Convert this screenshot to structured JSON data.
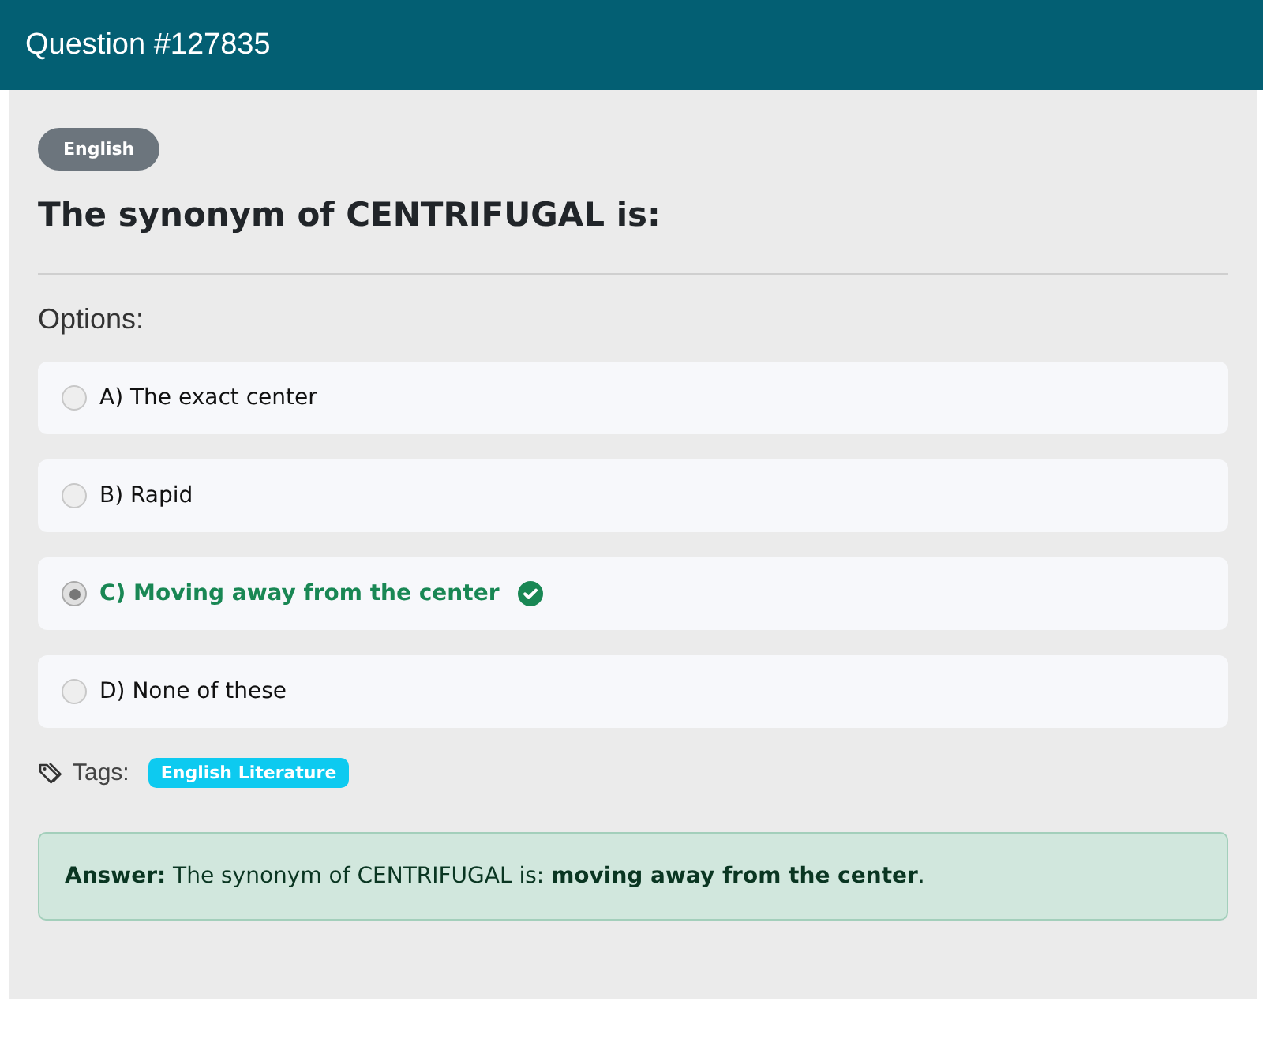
{
  "header": {
    "title": "Question #127835"
  },
  "category": "English",
  "question": "The synonym of CENTRIFUGAL is:",
  "options_label": "Options:",
  "options": [
    {
      "label": "A) The exact center",
      "selected": false,
      "correct": false
    },
    {
      "label": "B) Rapid",
      "selected": false,
      "correct": false
    },
    {
      "label": "C) Moving away from the center",
      "selected": true,
      "correct": true
    },
    {
      "label": "D) None of these",
      "selected": false,
      "correct": false
    }
  ],
  "tags_label": "Tags:",
  "tags": [
    "English Literature"
  ],
  "answer": "**Answer:** The synonym of CENTRIFUGAL is: **moving away from the center**."
}
